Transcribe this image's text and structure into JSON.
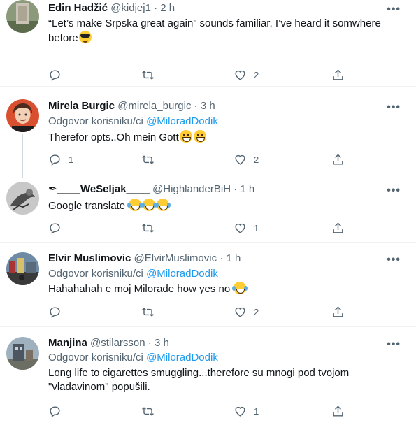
{
  "tweets": [
    {
      "name": "Edin Hadžić",
      "handle": "@kidjej1",
      "time": "2 h",
      "reply_prefix": "",
      "reply_mention": "",
      "text": "“Let’s make Srpska great again” sounds familiar, I’ve heard it somwhere before",
      "emojis": [
        "smiling-face-with-sunglasses"
      ],
      "replies": "",
      "retweets": "",
      "likes": "2"
    },
    {
      "name": "Mirela Burgic",
      "handle": "@mirela_burgic",
      "time": "3 h",
      "reply_prefix": "Odgovor korisniku/ci ",
      "reply_mention": "@MiloradDodik",
      "text": "Therefor opts..Oh mein Gott",
      "emojis": [
        "grinning-face",
        "grinning-face"
      ],
      "replies": "1",
      "retweets": "",
      "likes": "2"
    },
    {
      "name": "✒︎____WeSeljak____",
      "handle": "@HighlanderBiH",
      "time": "1 h",
      "reply_prefix": "",
      "reply_mention": "",
      "text": "Google translate",
      "emojis": [
        "face-with-tears-of-joy",
        "face-with-tears-of-joy",
        "face-with-tears-of-joy"
      ],
      "replies": "",
      "retweets": "",
      "likes": "1"
    },
    {
      "name": "Elvir Muslimovic",
      "handle": "@ElvirMuslimovic",
      "time": "1 h",
      "reply_prefix": "Odgovor korisniku/ci ",
      "reply_mention": "@MiloradDodik",
      "text": "Hahahahah e moj Milorade how yes no",
      "emojis": [
        "face-with-tears-of-joy"
      ],
      "replies": "",
      "retweets": "",
      "likes": "2"
    },
    {
      "name": "Manjina",
      "handle": "@stilarsson",
      "time": "3 h",
      "reply_prefix": "Odgovor korisniku/ci ",
      "reply_mention": "@MiloradDodik",
      "text": "Long life to cigarettes smuggling...therefore su mnogi pod tvojom \"vladavinom\" popušili.",
      "emojis": [],
      "replies": "",
      "retweets": "",
      "likes": "1"
    }
  ],
  "separator_dot": "·",
  "more_glyph": "•••",
  "icons": {
    "reply": "reply-icon",
    "retweet": "retweet-icon",
    "like": "heart-icon",
    "share": "share-icon",
    "more": "more-icon"
  },
  "colors": {
    "text": "#0f1419",
    "secondary": "#536471",
    "mention": "#1d9bf0",
    "separator": "#eff3f4",
    "thread_line": "#cfd9de"
  }
}
